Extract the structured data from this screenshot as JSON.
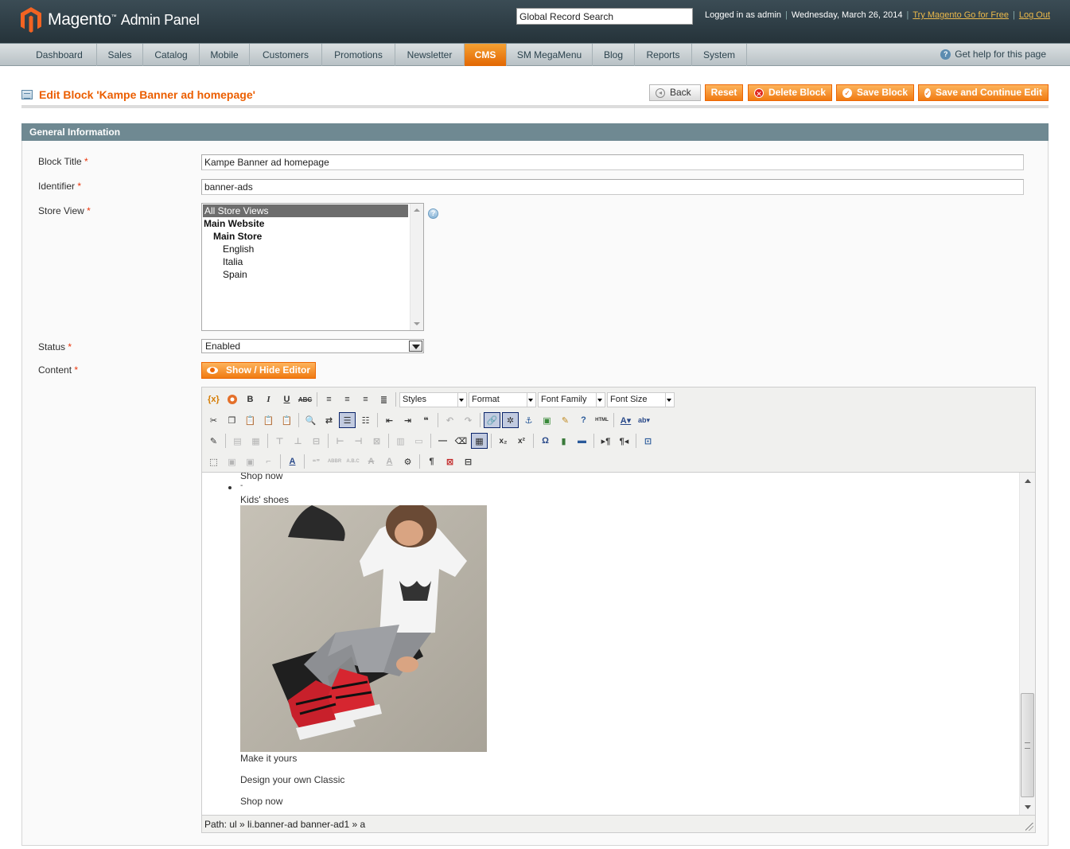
{
  "header": {
    "logo_main": "Magento",
    "logo_sub": "Admin Panel",
    "search_value": "Global Record Search",
    "logged_in": "Logged in as admin",
    "date": "Wednesday, March 26, 2014",
    "try_link": "Try Magento Go for Free",
    "logout": "Log Out"
  },
  "nav": {
    "items": [
      "Dashboard",
      "Sales",
      "Catalog",
      "Mobile",
      "Customers",
      "Promotions",
      "Newsletter",
      "CMS",
      "SM MegaMenu",
      "Blog",
      "Reports",
      "System"
    ],
    "active": "CMS",
    "help": "Get help for this page"
  },
  "page": {
    "title": "Edit Block 'Kampe Banner ad homepage'",
    "buttons": {
      "back": "Back",
      "reset": "Reset",
      "delete": "Delete Block",
      "save": "Save Block",
      "save_continue": "Save and Continue Edit"
    }
  },
  "form": {
    "section_title": "General Information",
    "block_title_label": "Block Title",
    "block_title_value": "Kampe Banner ad homepage",
    "identifier_label": "Identifier",
    "identifier_value": "banner-ads",
    "store_view_label": "Store View",
    "store_views": [
      "All Store Views",
      "Main Website",
      "Main Store",
      "English",
      "Italia",
      "Spain"
    ],
    "status_label": "Status",
    "status_value": "Enabled",
    "content_label": "Content",
    "show_hide": "Show / Hide Editor",
    "required_mark": "*"
  },
  "editor": {
    "dropdowns": [
      "Styles",
      "Format",
      "Font Family",
      "Font Size"
    ],
    "content": {
      "shop_now_top": "Shop now",
      "kids_shoes": "Kids' shoes",
      "make_it_yours": "Make it yours",
      "design": "Design your own Classic",
      "shop_now_bottom": "Shop now"
    },
    "path": "Path: ul » li.banner-ad banner-ad1 » a",
    "html_icon_text": "HTML"
  },
  "colors": {
    "accent": "#eb5e00",
    "header_bg": "#25333a",
    "section_head": "#6f8992"
  }
}
